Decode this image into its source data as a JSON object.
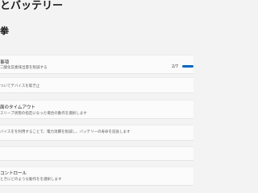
{
  "header": {
    "title": "とバッテリー",
    "section": "拳"
  },
  "items": [
    {
      "title": "事項",
      "subtitle": "二酸化炭素排出量を削減する",
      "value": "2/7",
      "progress": 0.28
    },
    {
      "title": "",
      "subtitle": "ついてデバイスを取ぎ止"
    },
    {
      "title": "面のタイムアウト",
      "subtitle": "スリープ状態の指定になった場合の動作を選択します"
    },
    {
      "title": "",
      "subtitle": "バイスをを利用することで、電力消費を削減し、バッテリーの寿命を延長します"
    },
    {
      "title": "",
      "subtitle": ""
    },
    {
      "title": "コントロール",
      "subtitle": "ときにどのような動作をを選択します"
    }
  ]
}
